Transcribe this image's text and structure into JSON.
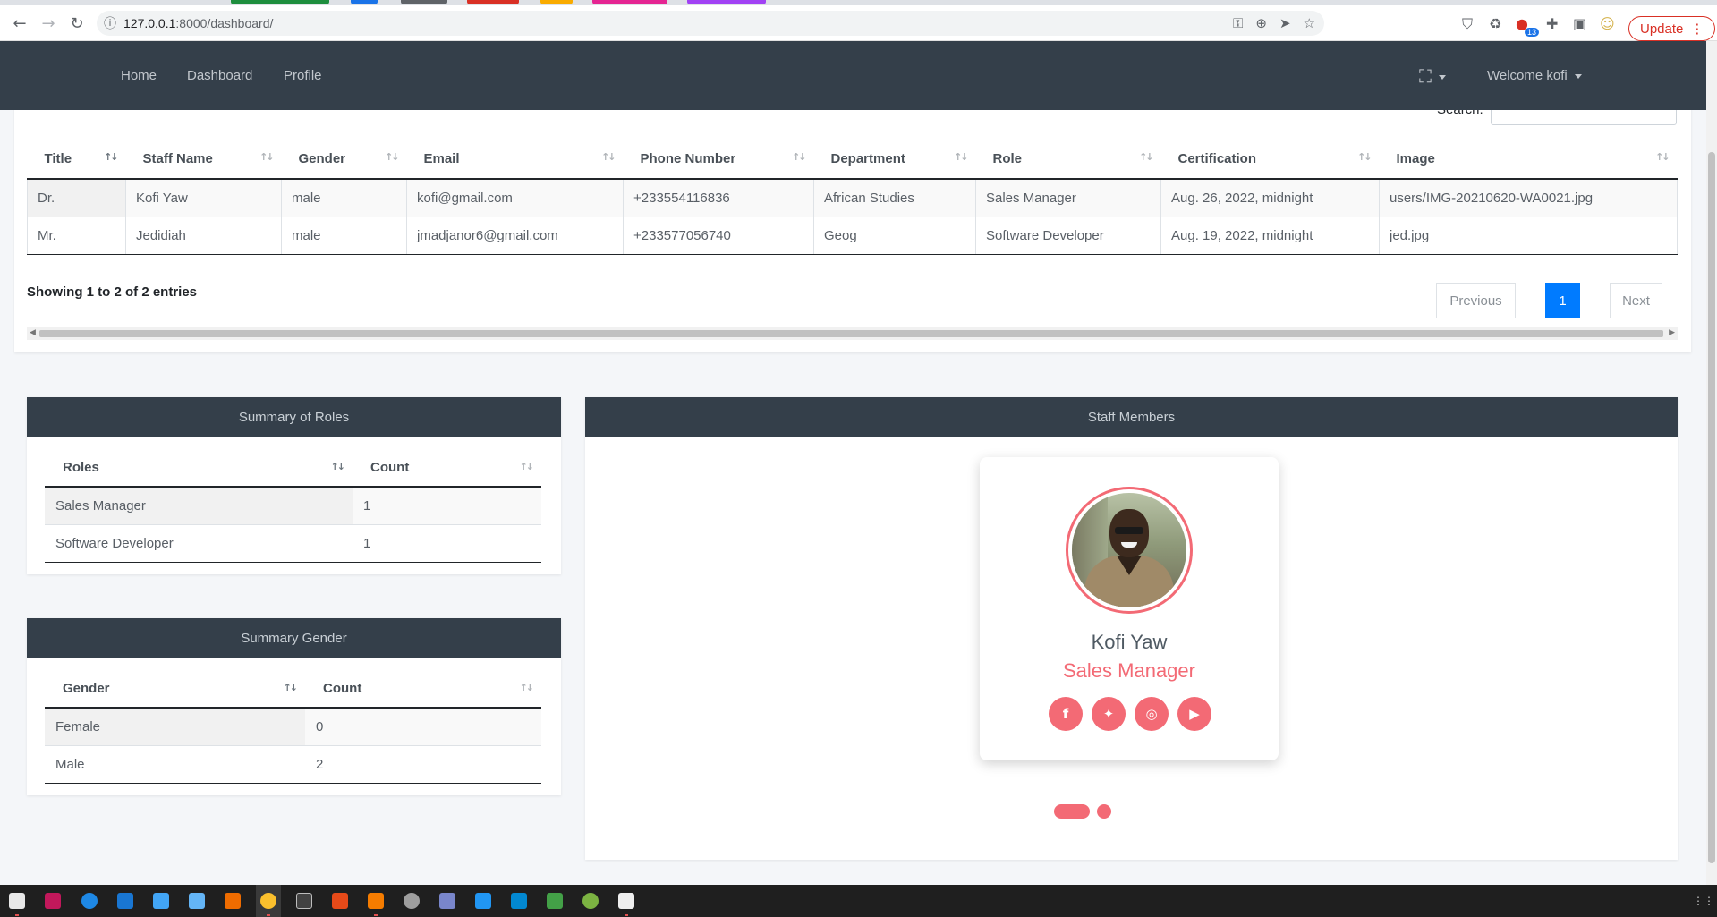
{
  "browser": {
    "url_host": "127.0.0.1",
    "url_rest": ":8000/dashboard/",
    "update_label": "Update",
    "extension_badge": "13"
  },
  "navbar": {
    "links": [
      "Home",
      "Dashboard",
      "Profile"
    ],
    "welcome": "Welcome kofi"
  },
  "staff_table": {
    "search_label": "Search:",
    "search_value": "",
    "columns": [
      "Title",
      "Staff Name",
      "Gender",
      "Email",
      "Phone Number",
      "Department",
      "Role",
      "Certification",
      "Image"
    ],
    "rows": [
      [
        "Dr.",
        "Kofi Yaw",
        "male",
        "kofi@gmail.com",
        "+233554116836",
        "African Studies",
        "Sales Manager",
        "Aug. 26, 2022, midnight",
        "users/IMG-20210620-WA0021.jpg"
      ],
      [
        "Mr.",
        "Jedidiah",
        "male",
        "jmadjanor6@gmail.com",
        "+233577056740",
        "Geog",
        "Software Developer",
        "Aug. 19, 2022, midnight",
        "jed.jpg"
      ]
    ],
    "info": "Showing 1 to 2 of 2 entries",
    "pagination": {
      "previous": "Previous",
      "current": "1",
      "next": "Next"
    }
  },
  "summary_roles": {
    "title": "Summary of Roles",
    "columns": [
      "Roles",
      "Count"
    ],
    "rows": [
      [
        "Sales Manager",
        "1"
      ],
      [
        "Software Developer",
        "1"
      ]
    ]
  },
  "summary_gender": {
    "title": "Summary Gender",
    "columns": [
      "Gender",
      "Count"
    ],
    "rows": [
      [
        "Female",
        "0"
      ],
      [
        "Male",
        "2"
      ]
    ]
  },
  "staff_members": {
    "title": "Staff Members",
    "card": {
      "name": "Kofi Yaw",
      "role": "Sales Manager",
      "socials": [
        "facebook-icon",
        "twitter-icon",
        "instagram-icon",
        "youtube-icon"
      ]
    },
    "carousel_slides": 2,
    "carousel_active": 1
  },
  "colors": {
    "navbar": "#343f4a",
    "accent": "#f36a75",
    "primary": "#007bff"
  }
}
